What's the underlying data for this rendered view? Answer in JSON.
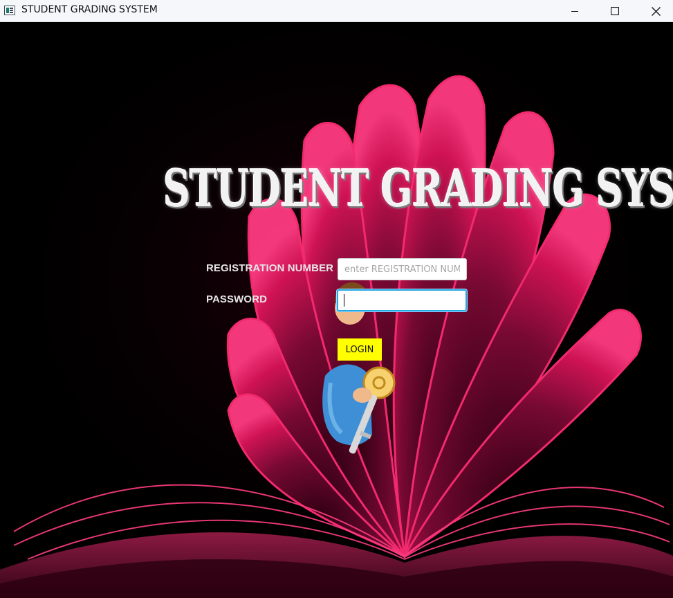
{
  "window": {
    "title": "STUDENT GRADING SYSTEM",
    "app_icon": "java-app-icon",
    "controls": [
      "minimize-icon",
      "maximize-icon",
      "close-icon"
    ]
  },
  "main": {
    "heading": "STUDENT GRADING SYSTEM",
    "registration": {
      "label": "REGISTRATION NUMBER",
      "placeholder": "enter REGISTRATION NUMBER",
      "value": ""
    },
    "password": {
      "label": "PASSWORD",
      "value": ""
    },
    "login_button": "LOGIN",
    "user_icon": "user-key-icon"
  },
  "colors": {
    "background": "#000000",
    "book_accent": "#e8105a",
    "login_button": "#ffff00",
    "focus_border": "#28a7e6"
  }
}
